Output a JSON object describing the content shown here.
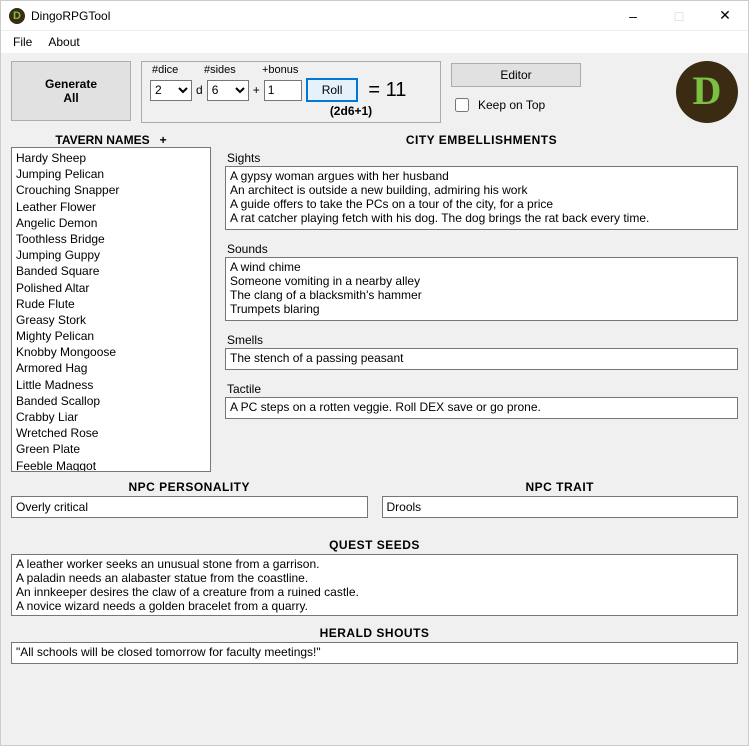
{
  "window": {
    "title": "DingoRPGTool"
  },
  "menu": {
    "file": "File",
    "about": "About"
  },
  "generateAll": "Generate\nAll",
  "dice": {
    "numDiceLabel": "#dice",
    "sidesLabel": "#sides",
    "bonusLabel": "+bonus",
    "numDice": "2",
    "sides": "6",
    "bonus": "1",
    "d": "d",
    "plus": "+",
    "rollLabel": "Roll",
    "resultPrefix": "= ",
    "result": "11",
    "formula": "(2d6+1)"
  },
  "editorLabel": "Editor",
  "keepOnTopLabel": "Keep on Top",
  "logoLetter": "D",
  "tavern": {
    "header": "TAVERN NAMES",
    "plus": "+",
    "items": [
      "Hardy Sheep",
      "Jumping Pelican",
      "Crouching Snapper",
      "Leather Flower",
      "Angelic Demon",
      "Toothless Bridge",
      "Jumping Guppy",
      "Banded Square",
      "Polished Altar",
      "Rude Flute",
      "Greasy Stork",
      "Mighty Pelican",
      "Knobby Mongoose",
      "Armored Hag",
      "Little Madness",
      "Banded Scallop",
      "Crabby Liar",
      "Wretched Rose",
      "Green Plate",
      "Feeble Maggot"
    ]
  },
  "embell": {
    "header": "CITY EMBELLISHMENTS",
    "sightsLabel": "Sights",
    "sights": "A gypsy woman argues with her husband\nAn architect is outside a new building, admiring his work\nA guide offers to take the PCs on a tour of the city, for a price\nA rat catcher playing fetch with his dog. The dog brings the rat back every time.",
    "soundsLabel": "Sounds",
    "sounds": "A wind chime\nSomeone vomiting in a nearby alley\nThe clang of a blacksmith's hammer\nTrumpets blaring",
    "smellsLabel": "Smells",
    "smells": "The stench of a passing peasant",
    "tactileLabel": "Tactile",
    "tactile": "A PC steps on a rotten veggie. Roll DEX save or go prone."
  },
  "npc": {
    "personalityHeader": "NPC PERSONALITY",
    "personality": "Overly critical",
    "traitHeader": "NPC TRAIT",
    "trait": "Drools"
  },
  "quest": {
    "header": "QUEST SEEDS",
    "text": "A leather worker seeks an unusual stone from a garrison.\nA paladin needs an alabaster statue from the coastline.\nAn innkeeper desires the claw of a creature from a ruined castle.\nA novice wizard needs a golden bracelet from a quarry."
  },
  "herald": {
    "header": "HERALD SHOUTS",
    "text": "\"All schools will be closed tomorrow for faculty meetings!\""
  }
}
